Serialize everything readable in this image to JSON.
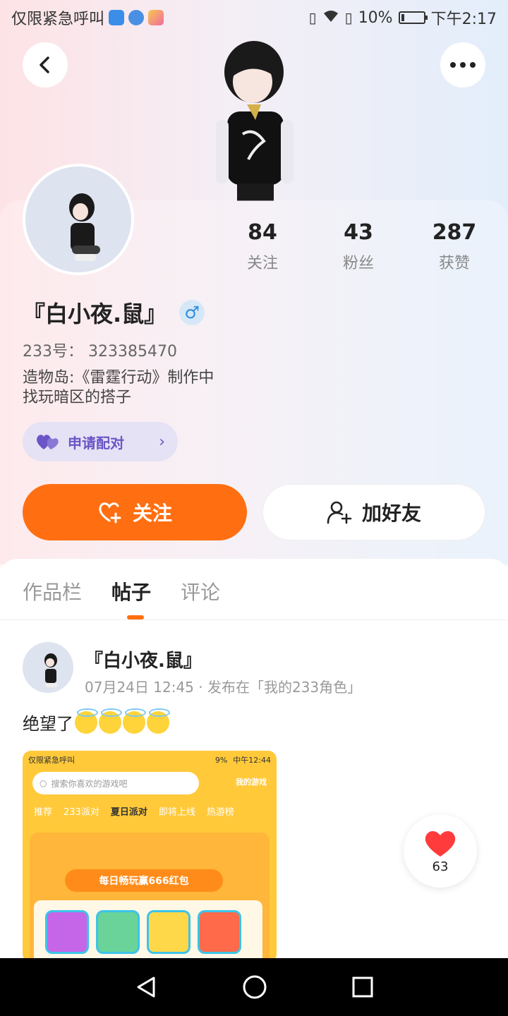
{
  "status_bar": {
    "carrier_text": "仅限紧急呼叫",
    "battery": "10%",
    "time": "下午2:17",
    "app_icon_colors": [
      "#3b8ee8",
      "#4a90e2",
      "#f06aa0"
    ]
  },
  "profile": {
    "name": "『白小夜.鼠』",
    "gender_symbol": "♂",
    "uid": "233号：  323385470",
    "bio_line1": "造物岛:《雷霆行动》制作中",
    "bio_line2": "找玩暗区的搭子",
    "stats": [
      {
        "value": "84",
        "label": "关注"
      },
      {
        "value": "43",
        "label": "粉丝"
      },
      {
        "value": "287",
        "label": "获赞"
      }
    ],
    "pair_button": "申请配对",
    "follow_button": "关注",
    "add_friend_button": "加好友"
  },
  "tabs": [
    {
      "label": "作品栏",
      "active": false
    },
    {
      "label": "帖子",
      "active": true
    },
    {
      "label": "评论",
      "active": false
    }
  ],
  "post": {
    "author": "『白小夜.鼠』",
    "meta": "07月24日 12:45 · 发布在「我的233角色」",
    "text": "绝望了",
    "emoji_name": "smiling-face-with-halo",
    "emoji_count": 4,
    "screenshot": {
      "status_left": "仅限紧急呼叫",
      "status_battery": "9%",
      "status_time": "中午12:44",
      "search_placeholder": "搜索你喜欢的游戏吧",
      "my_games": "我的游戏",
      "tabs": [
        "推荐",
        "233派对",
        "夏日派对",
        "即将上线",
        "热游榜"
      ],
      "banner": "每日畅玩赢666红包"
    }
  },
  "like": {
    "count": "63"
  },
  "colors": {
    "accent": "#ff6f12",
    "pair": "#6b55c6",
    "gender": "#2d8ee0"
  }
}
